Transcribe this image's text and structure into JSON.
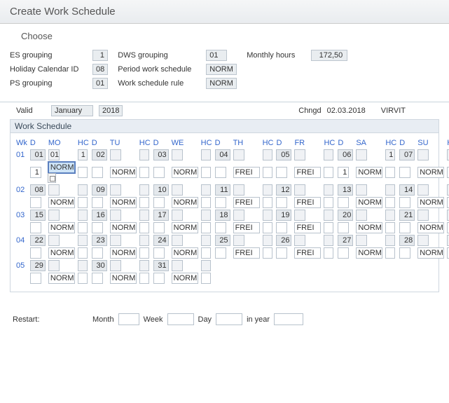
{
  "header": {
    "title": "Create Work Schedule",
    "choose": "Choose"
  },
  "form": {
    "left": {
      "es_grouping_label": "ES grouping",
      "es_grouping_value": "1",
      "holiday_calendar_label": "Holiday Calendar ID",
      "holiday_calendar_value": "08",
      "ps_grouping_label": "PS grouping",
      "ps_grouping_value": "01"
    },
    "mid": {
      "dws_grouping_label": "DWS grouping",
      "dws_grouping_value": "01",
      "period_ws_label": "Period work schedule",
      "period_ws_value": "NORM",
      "ws_rule_label": "Work schedule rule",
      "ws_rule_value": "NORM"
    },
    "right": {
      "monthly_hours_label": "Monthly hours",
      "monthly_hours_value": "172,50"
    }
  },
  "valid": {
    "label": "Valid",
    "month": "January",
    "year": "2018",
    "chngd_label": "Chngd",
    "chngd_date": "02.03.2018",
    "chngd_user": "VIRVIT"
  },
  "section": {
    "title": "Work Schedule"
  },
  "colhead": {
    "wk": "Wk",
    "d": "D",
    "mo": "MO",
    "hc": "HC",
    "tu": "TU",
    "we": "WE",
    "th": "TH",
    "fr": "FR",
    "sa": "SA",
    "su": "SU"
  },
  "weeks": [
    {
      "wk": "01",
      "days": [
        {
          "num": "01",
          "d": "01",
          "dws": "",
          "hc": "1",
          "d2": "1",
          "dws2": "NORM",
          "hc2": "",
          "sel": true
        },
        {
          "num": "02",
          "d": "",
          "dws": "",
          "hc": "",
          "d2": "",
          "dws2": "NORM",
          "hc2": ""
        },
        {
          "num": "03",
          "d": "",
          "dws": "",
          "hc": "",
          "d2": "",
          "dws2": "NORM",
          "hc2": ""
        },
        {
          "num": "04",
          "d": "",
          "dws": "",
          "hc": "",
          "d2": "",
          "dws2": "FREI",
          "hc2": ""
        },
        {
          "num": "05",
          "d": "",
          "dws": "",
          "hc": "",
          "d2": "",
          "dws2": "FREI",
          "hc2": ""
        },
        {
          "num": "06",
          "d": "",
          "dws": "",
          "hc": "1",
          "d2": "1",
          "dws2": "NORM",
          "hc2": ""
        },
        {
          "num": "07",
          "d": "",
          "dws": "",
          "hc": "",
          "d2": "",
          "dws2": "NORM",
          "hc2": ""
        }
      ]
    },
    {
      "wk": "02",
      "days": [
        {
          "num": "08",
          "d": "",
          "dws": "",
          "hc": "",
          "d2": "",
          "dws2": "NORM",
          "hc2": ""
        },
        {
          "num": "09",
          "d": "",
          "dws": "",
          "hc": "",
          "d2": "",
          "dws2": "NORM",
          "hc2": ""
        },
        {
          "num": "10",
          "d": "",
          "dws": "",
          "hc": "",
          "d2": "",
          "dws2": "NORM",
          "hc2": ""
        },
        {
          "num": "11",
          "d": "",
          "dws": "",
          "hc": "",
          "d2": "",
          "dws2": "FREI",
          "hc2": ""
        },
        {
          "num": "12",
          "d": "",
          "dws": "",
          "hc": "",
          "d2": "",
          "dws2": "FREI",
          "hc2": ""
        },
        {
          "num": "13",
          "d": "",
          "dws": "",
          "hc": "",
          "d2": "",
          "dws2": "NORM",
          "hc2": ""
        },
        {
          "num": "14",
          "d": "",
          "dws": "",
          "hc": "",
          "d2": "",
          "dws2": "NORM",
          "hc2": ""
        }
      ]
    },
    {
      "wk": "03",
      "days": [
        {
          "num": "15",
          "d": "",
          "dws": "",
          "hc": "",
          "d2": "",
          "dws2": "NORM",
          "hc2": ""
        },
        {
          "num": "16",
          "d": "",
          "dws": "",
          "hc": "",
          "d2": "",
          "dws2": "NORM",
          "hc2": ""
        },
        {
          "num": "17",
          "d": "",
          "dws": "",
          "hc": "",
          "d2": "",
          "dws2": "NORM",
          "hc2": ""
        },
        {
          "num": "18",
          "d": "",
          "dws": "",
          "hc": "",
          "d2": "",
          "dws2": "FREI",
          "hc2": ""
        },
        {
          "num": "19",
          "d": "",
          "dws": "",
          "hc": "",
          "d2": "",
          "dws2": "FREI",
          "hc2": ""
        },
        {
          "num": "20",
          "d": "",
          "dws": "",
          "hc": "",
          "d2": "",
          "dws2": "NORM",
          "hc2": ""
        },
        {
          "num": "21",
          "d": "",
          "dws": "",
          "hc": "",
          "d2": "",
          "dws2": "NORM",
          "hc2": ""
        }
      ]
    },
    {
      "wk": "04",
      "days": [
        {
          "num": "22",
          "d": "",
          "dws": "",
          "hc": "",
          "d2": "",
          "dws2": "NORM",
          "hc2": ""
        },
        {
          "num": "23",
          "d": "",
          "dws": "",
          "hc": "",
          "d2": "",
          "dws2": "NORM",
          "hc2": ""
        },
        {
          "num": "24",
          "d": "",
          "dws": "",
          "hc": "",
          "d2": "",
          "dws2": "NORM",
          "hc2": ""
        },
        {
          "num": "25",
          "d": "",
          "dws": "",
          "hc": "",
          "d2": "",
          "dws2": "FREI",
          "hc2": ""
        },
        {
          "num": "26",
          "d": "",
          "dws": "",
          "hc": "",
          "d2": "",
          "dws2": "FREI",
          "hc2": ""
        },
        {
          "num": "27",
          "d": "",
          "dws": "",
          "hc": "",
          "d2": "",
          "dws2": "NORM",
          "hc2": ""
        },
        {
          "num": "28",
          "d": "",
          "dws": "",
          "hc": "",
          "d2": "",
          "dws2": "NORM",
          "hc2": ""
        }
      ]
    },
    {
      "wk": "05",
      "days": [
        {
          "num": "29",
          "d": "",
          "dws": "",
          "hc": "",
          "d2": "",
          "dws2": "NORM",
          "hc2": ""
        },
        {
          "num": "30",
          "d": "",
          "dws": "",
          "hc": "",
          "d2": "",
          "dws2": "NORM",
          "hc2": ""
        },
        {
          "num": "31",
          "d": "",
          "dws": "",
          "hc": "",
          "d2": "",
          "dws2": "NORM",
          "hc2": ""
        }
      ]
    }
  ],
  "restart": {
    "label": "Restart:",
    "month": "Month",
    "week": "Week",
    "day": "Day",
    "in_year": "in year"
  }
}
